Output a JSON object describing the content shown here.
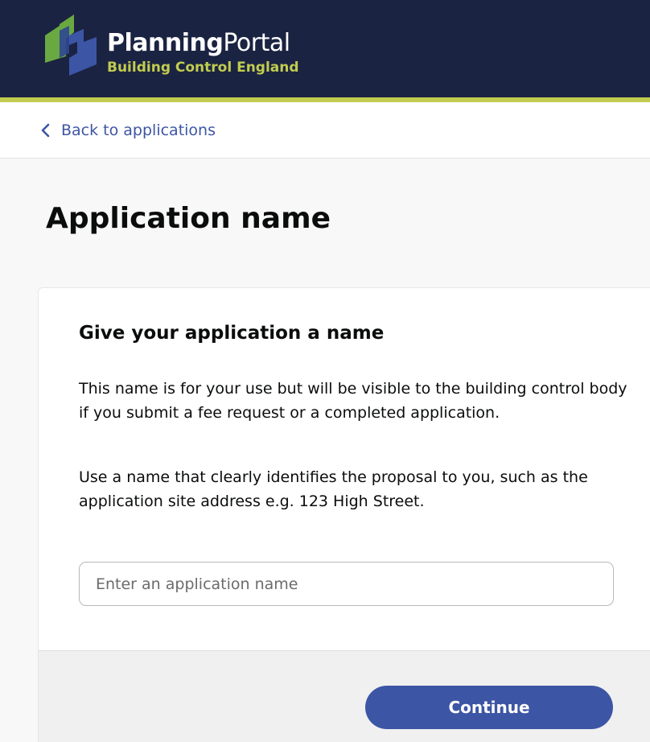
{
  "header": {
    "brand_strong": "Planning",
    "brand_light": "Portal",
    "subtitle": "Building Control England",
    "logo_icon": "planning-portal-logo-icon",
    "colors": {
      "navy": "#1b2342",
      "lime": "#c1cc4f",
      "green": "#6aa842",
      "blue": "#3d55a5"
    }
  },
  "nav": {
    "back_label": "Back to applications",
    "back_icon": "chevron-left-icon"
  },
  "page": {
    "title": "Application name"
  },
  "form": {
    "heading": "Give your application a name",
    "paragraph1": "This name is for your use but will be visible to the building control body if you submit a fee request or a completed application.",
    "paragraph2": "Use a name that clearly identifies the proposal to you, such as the application site address e.g. 123 High Street.",
    "input_value": "",
    "input_placeholder": "Enter an application name",
    "continue_label": "Continue"
  }
}
